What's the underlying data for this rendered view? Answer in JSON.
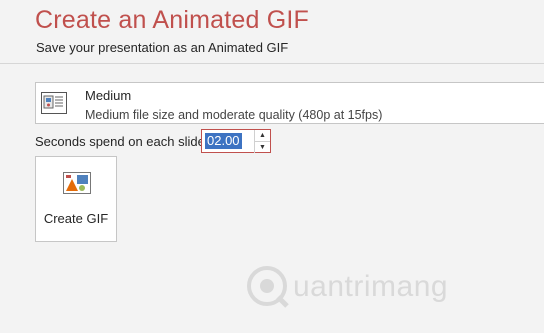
{
  "header": {
    "title": "Create an Animated GIF",
    "subtitle": "Save your presentation as an Animated GIF"
  },
  "quality": {
    "icon": "presentation-quality-icon",
    "name": "Medium",
    "description": "Medium file size and moderate quality (480p at 15fps)"
  },
  "timing": {
    "label": "Seconds spend on each slide:",
    "value": "02.00",
    "up_glyph": "▲",
    "down_glyph": "▼"
  },
  "create": {
    "icon": "animated-gif-icon",
    "label": "Create GIF"
  },
  "watermark": {
    "text": "uantrimang"
  },
  "colors": {
    "title": "#c0504d",
    "selection": "#3d73c2",
    "background": "#f3f3f3"
  }
}
